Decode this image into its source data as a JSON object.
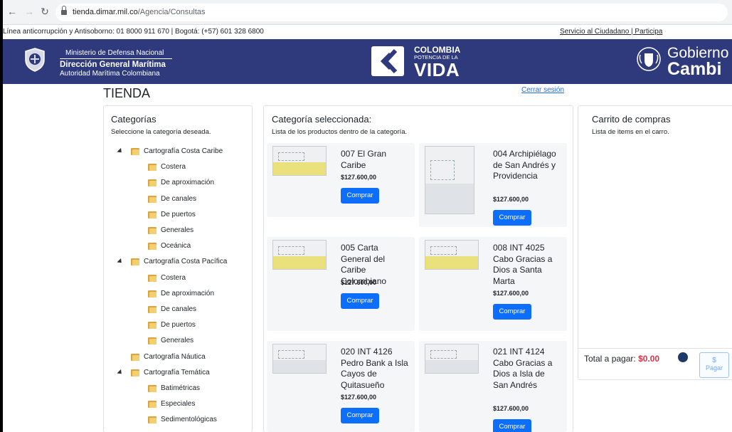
{
  "browser": {
    "url_host": "tienda.dimar.mil.co",
    "url_path": "/Agencia/Consultas"
  },
  "info_strip": {
    "hotline": "Línea anticorrupción y Antisoborno: 01 8000 911 670 | Bogotá: (+57) 601 328 6800",
    "links": "Servicio al Ciudadano | Participa"
  },
  "header": {
    "ministry": "Ministerio de Defensa Nacional",
    "direction": "Dirección General Marítima",
    "authority": "Autoridad Marítima Colombiana",
    "co_word": "COLOMBIA",
    "co_small": "POTENCIA DE LA",
    "co_vida": "VIDA",
    "gob_line1": "Gobierno d",
    "gob_line2": "Cambi",
    "brand_color": "#2f3a7d"
  },
  "page": {
    "title": "TIENDA",
    "logout": "Cerrar sesión"
  },
  "categories": {
    "title": "Categorías",
    "subtitle": "Seleccione la categoría deseada.",
    "tree": [
      {
        "label": "Cartografía Costa Caribe",
        "expanded": true,
        "children": [
          "Costera",
          "De aproximación",
          "De canales",
          "De puertos",
          "Generales",
          "Oceánica"
        ]
      },
      {
        "label": "Cartografía Costa Pacífica",
        "expanded": true,
        "children": [
          "Costera",
          "De aproximación",
          "De canales",
          "De puertos",
          "Generales"
        ]
      },
      {
        "label": "Cartografía Náutica",
        "expanded": false,
        "children": []
      },
      {
        "label": "Cartografía Temática",
        "expanded": true,
        "children": [
          "Batimétricas",
          "Especiales",
          "Sedimentológicas"
        ]
      }
    ]
  },
  "products": {
    "title": "Categoría seleccionada:",
    "subtitle": "Lista de los productos dentro de la categoría.",
    "buy_label": "Comprar",
    "items": [
      {
        "name": "007 El Gran Caribe",
        "price": "$127.600,00"
      },
      {
        "name": "004 Archipiélago de San Andrés y Providencia",
        "price": "$127.600,00"
      },
      {
        "name": "005 Carta General del Caribe Colombiano",
        "price": "$127.600,00"
      },
      {
        "name": "008 INT 4025 Cabo Gracias a Dios a Santa Marta",
        "price": "$127.600,00"
      },
      {
        "name": "020 INT 4126 Pedro Bank a Isla Cayos de Quitasueño",
        "price": "$127.600,00"
      },
      {
        "name": "021 INT 4124 Cabo Gracias a Dios a Isla de San Andrés",
        "price": "$127.600,00"
      }
    ]
  },
  "cart": {
    "title": "Carrito de compras",
    "subtitle": "Lista de items en el carro.",
    "total_label": "Total a pagar:",
    "total_value": "$0.00",
    "pay_symbol": "$",
    "pay_label": "Pagar"
  }
}
